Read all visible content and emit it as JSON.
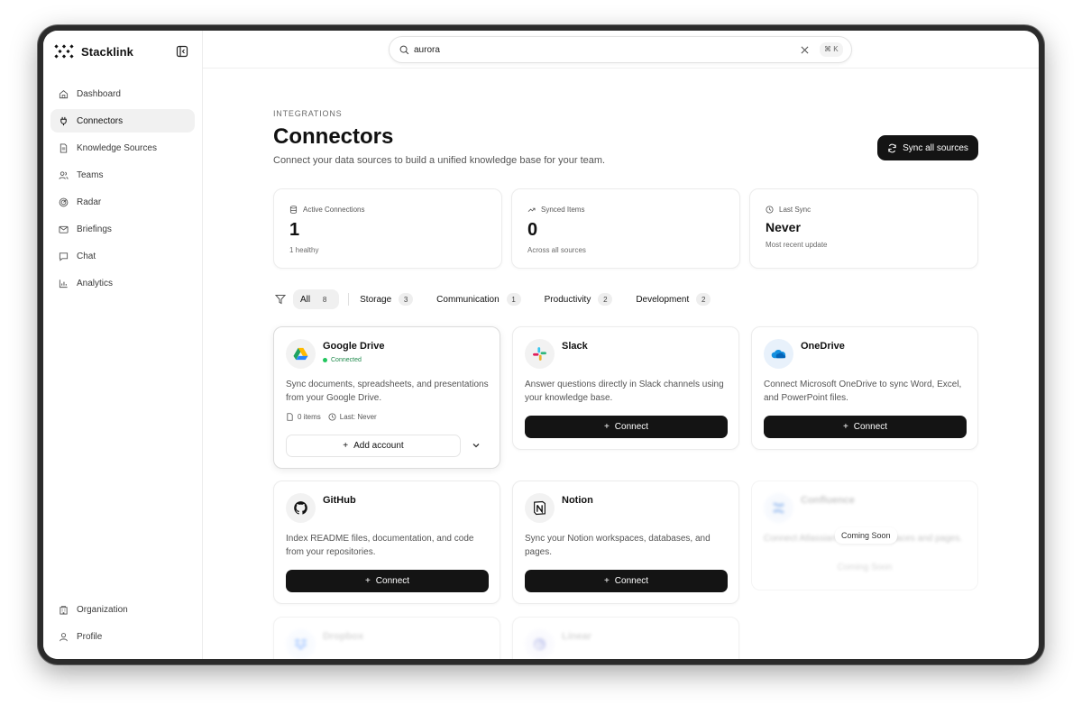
{
  "app": {
    "name": "Stacklink"
  },
  "sidebar": {
    "items": [
      {
        "label": "Dashboard",
        "icon": "home-icon",
        "active": false
      },
      {
        "label": "Connectors",
        "icon": "plug-icon",
        "active": true
      },
      {
        "label": "Knowledge Sources",
        "icon": "file-icon",
        "active": false
      },
      {
        "label": "Teams",
        "icon": "users-icon",
        "active": false
      },
      {
        "label": "Radar",
        "icon": "radar-icon",
        "active": false
      },
      {
        "label": "Briefings",
        "icon": "mail-icon",
        "active": false
      },
      {
        "label": "Chat",
        "icon": "chat-icon",
        "active": false
      },
      {
        "label": "Analytics",
        "icon": "chart-icon",
        "active": false
      }
    ],
    "bottom": [
      {
        "label": "Organization",
        "icon": "building-icon"
      },
      {
        "label": "Profile",
        "icon": "user-icon"
      }
    ]
  },
  "search": {
    "value": "aurora",
    "shortcut": "⌘ K"
  },
  "page": {
    "eyebrow": "INTEGRATIONS",
    "title": "Connectors",
    "subtitle": "Connect your data sources to build a unified knowledge base for your team.",
    "sync_label": "Sync all sources"
  },
  "stats": [
    {
      "label": "Active Connections",
      "value": "1",
      "note": "1 healthy",
      "icon": "database-icon"
    },
    {
      "label": "Synced Items",
      "value": "0",
      "note": "Across all sources",
      "icon": "trend-icon"
    },
    {
      "label": "Last Sync",
      "value": "Never",
      "note": "Most recent update",
      "icon": "clock-icon"
    }
  ],
  "filters": [
    {
      "label": "All",
      "count": "8",
      "active": true
    },
    {
      "label": "Storage",
      "count": "3",
      "active": false
    },
    {
      "label": "Communication",
      "count": "1",
      "active": false
    },
    {
      "label": "Productivity",
      "count": "2",
      "active": false
    },
    {
      "label": "Development",
      "count": "2",
      "active": false
    }
  ],
  "connectors": {
    "gdrive": {
      "name": "Google Drive",
      "status": "Connected",
      "desc": "Sync documents, spreadsheets, and presentations from your Google Drive.",
      "items": "0 items",
      "last": "Last: Never",
      "action": "Add account"
    },
    "slack": {
      "name": "Slack",
      "desc": "Answer questions directly in Slack channels using your knowledge base.",
      "action": "Connect"
    },
    "onedrive": {
      "name": "OneDrive",
      "desc": "Connect Microsoft OneDrive to sync Word, Excel, and PowerPoint files.",
      "action": "Connect"
    },
    "github": {
      "name": "GitHub",
      "desc": "Index README files, documentation, and code from your repositories.",
      "action": "Connect"
    },
    "notion": {
      "name": "Notion",
      "desc": "Sync your Notion workspaces, databases, and pages.",
      "action": "Connect"
    },
    "confluence": {
      "name": "Confluence",
      "badge": "Coming Soon",
      "desc": "Connect Atlassian Confluence spaces and pages.",
      "action": "Coming Soon"
    },
    "dropbox": {
      "name": "Dropbox"
    },
    "linear": {
      "name": "Linear"
    }
  }
}
